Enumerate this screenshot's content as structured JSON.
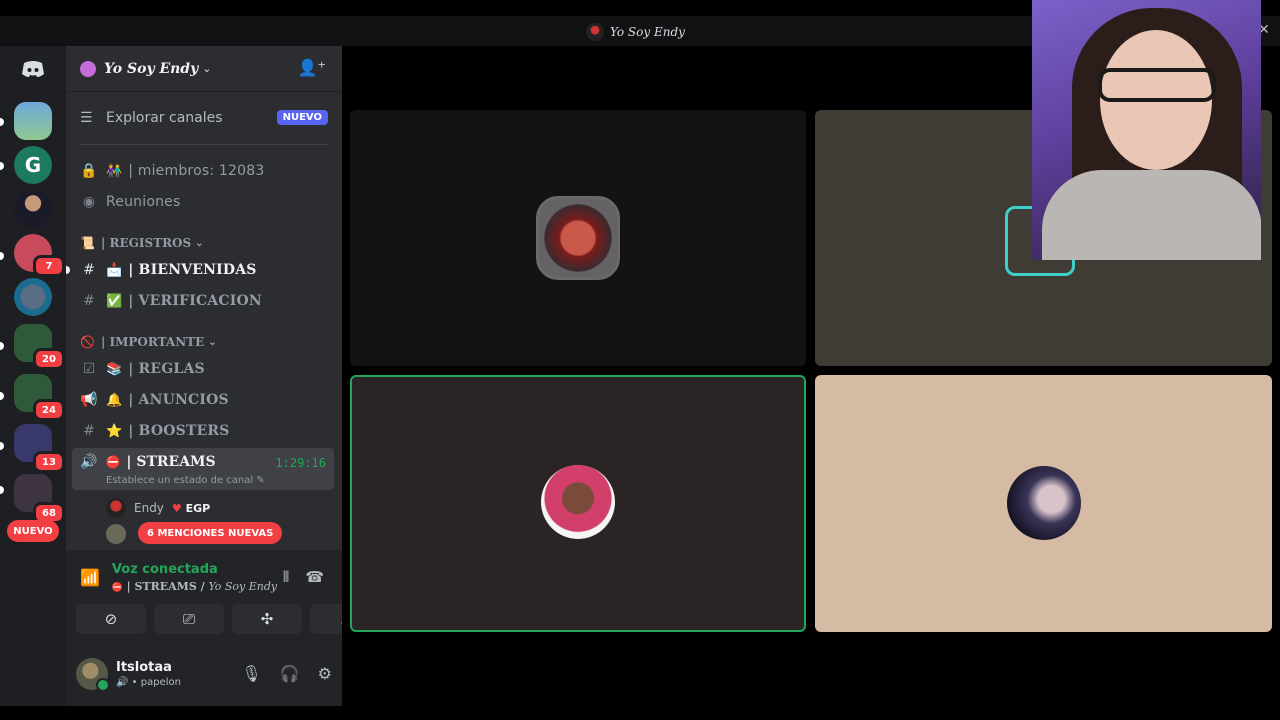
{
  "window": {
    "title": "Yo Soy Endy"
  },
  "rail": {
    "badges": [
      "7",
      "20",
      "24",
      "13",
      "68"
    ],
    "nuevo_label": "NUEVO"
  },
  "guild": {
    "name": "Yo Soy Endy"
  },
  "sidebar": {
    "explore_label": "Explorar canales",
    "explore_badge": "NUEVO",
    "members_label": "| miembros: 12083",
    "meetings_label": "Reuniones",
    "categories": {
      "registros": "| REGISTROS",
      "importante": "| IMPORTANTE"
    },
    "channels": {
      "bienvenidas": "| BIENVENIDAS",
      "verificacion": "| VERIFICACION",
      "reglas": "| REGLAS",
      "anuncios": "| ANUNCIOS",
      "boosters": "| BOOSTERS",
      "streams": "| STREAMS"
    },
    "voice": {
      "time": "1:29:16",
      "status_placeholder": "Establece un estado de canal",
      "user1_name": "Endy",
      "user1_tag": "EGP",
      "mentions_label": "6 MENCIONES NUEVAS"
    }
  },
  "panel": {
    "connected_label": "Voz conectada",
    "channel_path_channel": "| STREAMS / ",
    "channel_path_guild": "Yo Soy Endy",
    "user_name": "Itslotaa",
    "user_status": "• papelon"
  },
  "colors": {
    "accent": "#5865f2",
    "danger": "#f23f43",
    "online": "#23a55a"
  }
}
